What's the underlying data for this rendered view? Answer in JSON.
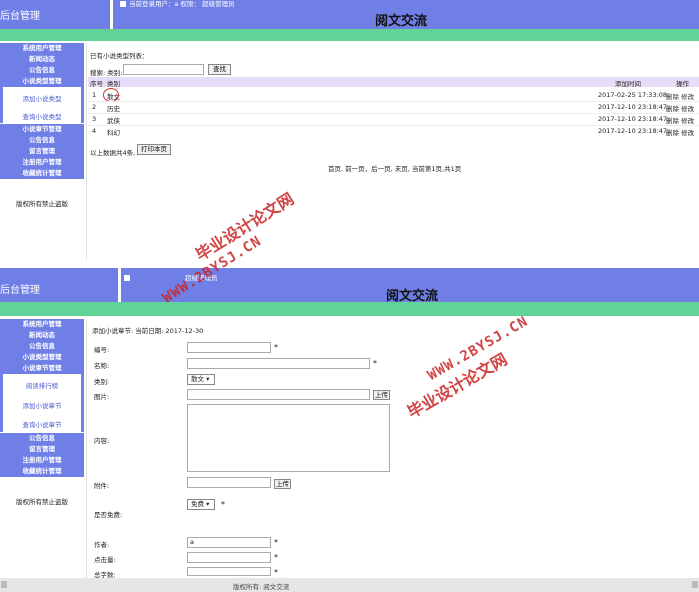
{
  "panel1": {
    "brand": "后台管理",
    "login_info": "当前登录用户：a 权限： 超级管理员",
    "title": "阅文交流",
    "sidebar": {
      "items": [
        "系统用户管理",
        "新闻动态",
        "公告信息",
        "小说类型管理"
      ],
      "sub_links": [
        "添加小说类型",
        "查询小说类型"
      ],
      "items_after": [
        "小说章节管理",
        "公告信息",
        "留言管理",
        "注册用户管理",
        "收藏统计管理"
      ],
      "copyright": "版权所有禁止盗版"
    },
    "list_title": "已有小说类型列表：",
    "search_label": "搜索: 类别:",
    "search_value": "",
    "search_button": "查找",
    "columns": [
      "序号",
      "类别",
      "添加时间",
      "操作"
    ],
    "rows": [
      {
        "no": "1",
        "category": "散文",
        "time": "2017-02-25 17:33:08",
        "actions": "删除 修改"
      },
      {
        "no": "2",
        "category": "历史",
        "time": "2017-12-10 23:18:47",
        "actions": "删除 修改"
      },
      {
        "no": "3",
        "category": "武侠",
        "time": "2017-12-10 23:18:47",
        "actions": "删除 修改"
      },
      {
        "no": "4",
        "category": "科幻",
        "time": "2017-12-10 23:18:47",
        "actions": "删除 修改"
      }
    ],
    "total_text": "以上数据共4条,",
    "print_button": "打印本页",
    "pagination": "首页, 前一页，后一页, 末页, 当前第1页,共1页"
  },
  "panel2": {
    "brand": "后台管理",
    "login_info": "超级管理员",
    "title": "阅文交流",
    "sidebar": {
      "items": [
        "系统用户管理",
        "新闻动态",
        "公告信息",
        "小说类型管理",
        "小说章节管理"
      ],
      "sub_links": [
        "阅读排行榜",
        "添加小说章节",
        "查询小说章节"
      ],
      "items_after": [
        "公告信息",
        "留言管理",
        "注册用户管理",
        "收藏统计管理"
      ],
      "copyright": "版权所有禁止盗版"
    },
    "form_header": "添加小说章节: 当前日期: 2017-12-30",
    "fields": {
      "bianhao": {
        "label": "编号:",
        "value": ""
      },
      "mingcheng": {
        "label": "名称:",
        "value": ""
      },
      "leibie": {
        "label": "类别:",
        "value": "散文"
      },
      "tupian": {
        "label": "图片:",
        "value": "",
        "button": "上传"
      },
      "neirong": {
        "label": "内容:"
      },
      "fujian": {
        "label": "附件:",
        "value": "",
        "button": "上传"
      },
      "mianfei": {
        "label": "是否免费:",
        "value": "免费"
      },
      "zuozhe": {
        "label": "作者:",
        "value": "a"
      },
      "dianjiliang": {
        "label": "点击量:",
        "value": ""
      },
      "zishu": {
        "label": "总字数:",
        "value": ""
      }
    },
    "required_mark": "*"
  },
  "footer": {
    "text": "版权所有: 阅文交流"
  },
  "watermarks": [
    "毕业设计论文网",
    "WWW.2BYSJ.CN"
  ],
  "colors": {
    "header": "#6f7fe6",
    "green_bar": "#62d396",
    "table_header": "#e7dcf7",
    "link": "#4b59d4",
    "watermark": "#c92424"
  }
}
